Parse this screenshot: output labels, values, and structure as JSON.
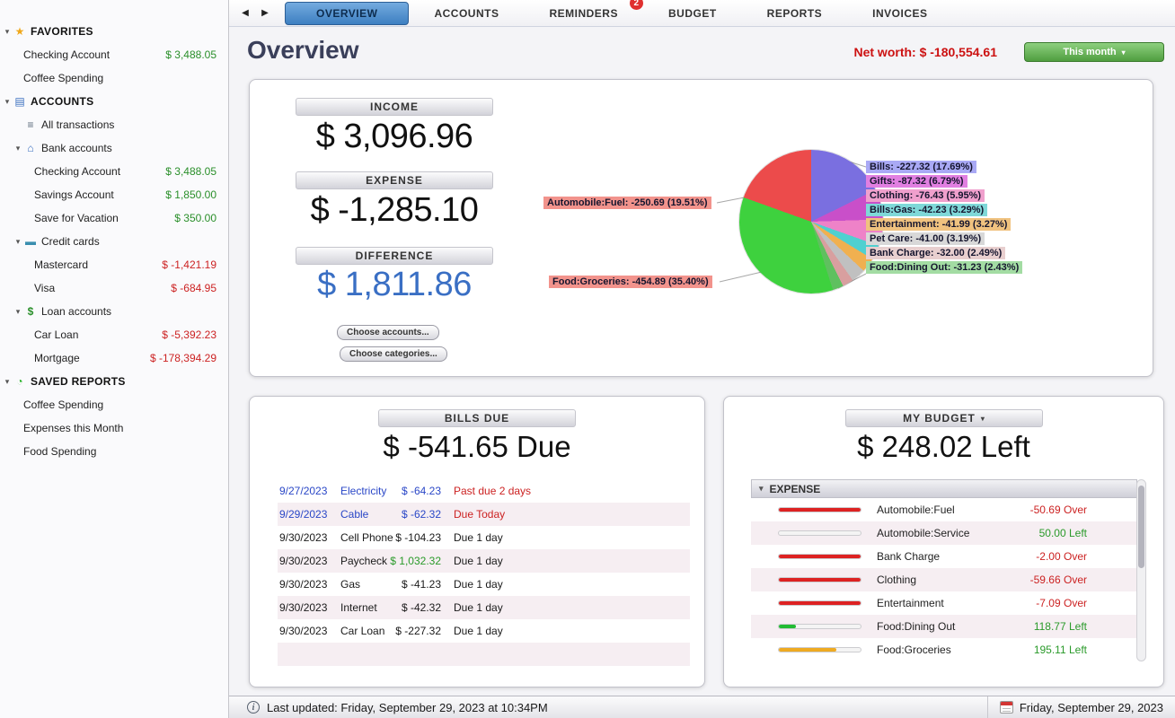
{
  "tabbar": {
    "tabs": [
      {
        "label": "OVERVIEW",
        "active": true
      },
      {
        "label": "ACCOUNTS"
      },
      {
        "label": "REMINDERS",
        "badge": "2"
      },
      {
        "label": "BUDGET"
      },
      {
        "label": "REPORTS"
      },
      {
        "label": "INVOICES"
      }
    ]
  },
  "sidebar": {
    "rows": [
      {
        "label": "FAVORITES",
        "type": "section",
        "icon": "star",
        "chevron": true
      },
      {
        "label": "Checking Account",
        "amount": "$ 3,488.05",
        "indent": 1
      },
      {
        "label": "Coffee Spending",
        "indent": 1
      },
      {
        "label": "ACCOUNTS",
        "type": "section",
        "icon": "book",
        "chevron": true
      },
      {
        "label": "All transactions",
        "icon": "list",
        "indent": 1
      },
      {
        "label": "Bank accounts",
        "icon": "bank",
        "chevron": true,
        "indent": 1
      },
      {
        "label": "Checking Account",
        "amount": "$ 3,488.05",
        "indent": 2
      },
      {
        "label": "Savings Account",
        "amount": "$ 1,850.00",
        "indent": 2
      },
      {
        "label": "Save for Vacation",
        "amount": "$ 350.00",
        "indent": 2
      },
      {
        "label": "Credit cards",
        "icon": "card",
        "chevron": true,
        "indent": 1
      },
      {
        "label": "Mastercard",
        "amount": "$ -1,421.19",
        "indent": 2
      },
      {
        "label": "Visa",
        "amount": "$ -684.95",
        "indent": 2
      },
      {
        "label": "Loan accounts",
        "icon": "money",
        "chevron": true,
        "indent": 1
      },
      {
        "label": "Car Loan",
        "amount": "$ -5,392.23",
        "indent": 2
      },
      {
        "label": "Mortgage",
        "amount": "$ -178,394.29",
        "indent": 2
      },
      {
        "label": "SAVED REPORTS",
        "type": "section",
        "icon": "pie",
        "chevron": true
      },
      {
        "label": "Coffee Spending",
        "indent": 1
      },
      {
        "label": "Expenses this Month",
        "indent": 1
      },
      {
        "label": "Food Spending",
        "indent": 1
      }
    ]
  },
  "overview": {
    "page_title": "Overview",
    "net_worth_label": "Net worth:",
    "net_worth_value": "$ -180,554.61",
    "period_button": "This month",
    "income_label": "INCOME",
    "income_value": "$ 3,096.96",
    "expense_label": "EXPENSE",
    "expense_value": "$ -1,285.10",
    "difference_label": "DIFFERENCE",
    "difference_value": "$ 1,811.86",
    "choose_accounts": "Choose accounts...",
    "choose_categories": "Choose categories..."
  },
  "chart_data": {
    "type": "pie",
    "title": "Expenses by category",
    "slices": [
      {
        "label": "Bills",
        "value": -227.32,
        "pct": 17.69,
        "color": "#7a6fe0"
      },
      {
        "label": "Gifts",
        "value": -87.32,
        "pct": 6.79,
        "color": "#c94fc9"
      },
      {
        "label": "Clothing",
        "value": -76.43,
        "pct": 5.95,
        "color": "#ee82c8"
      },
      {
        "label": "Bills:Gas",
        "value": -42.23,
        "pct": 3.29,
        "color": "#4fd0d0"
      },
      {
        "label": "Entertainment",
        "value": -41.99,
        "pct": 3.27,
        "color": "#f0b050"
      },
      {
        "label": "Pet Care",
        "value": -41.0,
        "pct": 3.19,
        "color": "#c0c0c0"
      },
      {
        "label": "Bank Charge",
        "value": -32.0,
        "pct": 2.49,
        "color": "#d89f9f"
      },
      {
        "label": "Food:Dining Out",
        "value": -31.23,
        "pct": 2.43,
        "color": "#5fc05f"
      },
      {
        "label": "Food:Groceries",
        "value": -454.89,
        "pct": 35.4,
        "color": "#3ed13e"
      },
      {
        "label": "Automobile:Fuel",
        "value": -250.69,
        "pct": 19.51,
        "color": "#ec4b4b"
      }
    ],
    "labels_left": [
      {
        "text": "Automobile:Fuel: -250.69 (19.51%)",
        "bg": "#f2938c"
      },
      {
        "text": "Food:Groceries: -454.89 (35.40%)",
        "bg": "#f2938c"
      }
    ],
    "labels_right": [
      {
        "text": "Bills: -227.32 (17.69%)",
        "bg": "#a9a9f5"
      },
      {
        "text": "Gifts: -87.32 (6.79%)",
        "bg": "#e17fe1"
      },
      {
        "text": "Clothing: -76.43 (5.95%)",
        "bg": "#f0a0cd"
      },
      {
        "text": "Bills:Gas: -42.23 (3.29%)",
        "bg": "#7fd8d8"
      },
      {
        "text": "Entertainment: -41.99 (3.27%)",
        "bg": "#f0c27f"
      },
      {
        "text": "Pet Care: -41.00 (3.19%)",
        "bg": "#d8d8d8"
      },
      {
        "text": "Bank Charge: -32.00 (2.49%)",
        "bg": "#e8cfcf"
      },
      {
        "text": "Food:Dining Out: -31.23 (2.43%)",
        "bg": "#a3dca3"
      }
    ]
  },
  "bills_due": {
    "header": "BILLS DUE",
    "total": "$ -541.65 Due",
    "rows": [
      {
        "date": "9/27/2023",
        "name": "Electricity",
        "amount": "$ -64.23",
        "status": "Past due 2 days",
        "text_color": "#2a47c7",
        "status_color": "#cc2222"
      },
      {
        "date": "9/29/2023",
        "name": "Cable",
        "amount": "$ -62.32",
        "status": "Due Today",
        "text_color": "#2a47c7",
        "status_color": "#cc2222"
      },
      {
        "date": "9/30/2023",
        "name": "Cell Phone",
        "amount": "$ -104.23",
        "status": "Due 1 day"
      },
      {
        "date": "9/30/2023",
        "name": "Paycheck",
        "amount": "$ 1,032.32",
        "status": "Due 1 day",
        "amount_color": "#2a9a2a"
      },
      {
        "date": "9/30/2023",
        "name": "Gas",
        "amount": "$ -41.23",
        "status": "Due 1 day"
      },
      {
        "date": "9/30/2023",
        "name": "Internet",
        "amount": "$ -42.32",
        "status": "Due 1 day"
      },
      {
        "date": "9/30/2023",
        "name": "Car Loan",
        "amount": "$ -227.32",
        "status": "Due 1 day"
      },
      {
        "date": "",
        "name": "",
        "amount": "",
        "status": ""
      }
    ]
  },
  "budget": {
    "header": "MY BUDGET",
    "total": "$ 248.02 Left",
    "section": "EXPENSE",
    "rows": [
      {
        "category": "Automobile:Fuel",
        "fill_pct": 100,
        "bar_color": "#dd2222",
        "amount": "-50.69 Over",
        "amount_color": "#cc2222"
      },
      {
        "category": "Automobile:Service",
        "fill_pct": 0,
        "bar_color": "#dd2222",
        "amount": "50.00 Left",
        "amount_color": "#2a9a2a"
      },
      {
        "category": "Bank Charge",
        "fill_pct": 100,
        "bar_color": "#dd2222",
        "amount": "-2.00 Over",
        "amount_color": "#cc2222"
      },
      {
        "category": "Clothing",
        "fill_pct": 100,
        "bar_color": "#dd2222",
        "amount": "-59.66 Over",
        "amount_color": "#cc2222"
      },
      {
        "category": "Entertainment",
        "fill_pct": 100,
        "bar_color": "#dd2222",
        "amount": "-7.09 Over",
        "amount_color": "#cc2222"
      },
      {
        "category": "Food:Dining Out",
        "fill_pct": 21,
        "bar_color": "#22bb33",
        "amount": "118.77 Left",
        "amount_color": "#2a9a2a"
      },
      {
        "category": "Food:Groceries",
        "fill_pct": 70,
        "bar_color": "#eeaa22",
        "amount": "195.11 Left",
        "amount_color": "#2a9a2a"
      }
    ]
  },
  "status_bar": {
    "last_updated": "Last updated: Friday, September 29, 2023 at 10:34PM",
    "date": "Friday, September 29, 2023"
  }
}
